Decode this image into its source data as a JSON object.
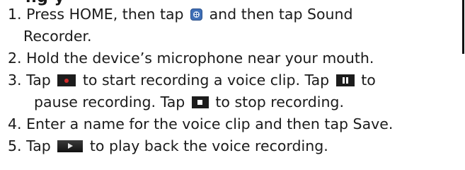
{
  "heading_fragment": "ng y",
  "steps": [
    {
      "number": "1.",
      "line1_a": "Press HOME, then tap",
      "icon1": "all-apps-icon",
      "line1_b": "and then tap Sound",
      "line2": "Recorder."
    },
    {
      "number": "2.",
      "text": "Hold the device’s microphone near your mouth."
    },
    {
      "number": "3.",
      "line1_a": "Tap",
      "icon1": "record-icon",
      "line1_b": "to start recording a voice clip. Tap",
      "icon2": "pause-icon",
      "line1_c": "to",
      "line2_a": "pause recording. Tap",
      "icon3": "stop-icon",
      "line2_b": " to stop recording."
    },
    {
      "number": "4.",
      "text": "Enter a name for the voice clip and then tap Save."
    },
    {
      "number": "5.",
      "line1_a": "Tap",
      "icon1": "play-icon",
      "line1_b": "to play back the voice recording."
    }
  ]
}
